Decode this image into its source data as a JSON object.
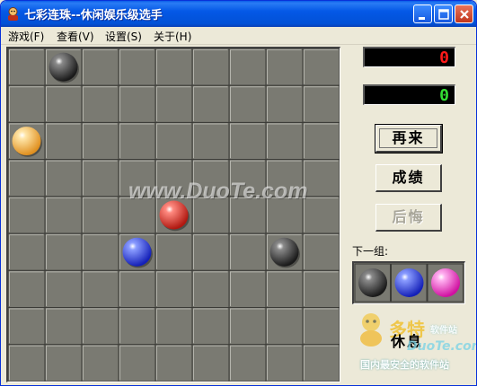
{
  "window": {
    "title": "七彩连珠--休闲娱乐级选手"
  },
  "menu": {
    "items": [
      "游戏(F)",
      "查看(V)",
      "设置(S)",
      "关于(H)"
    ]
  },
  "scores": {
    "current": "0",
    "current_color": "#ff1a1a",
    "best": "0",
    "best_color": "#33dd33"
  },
  "buttons": {
    "restart": "再来",
    "scores": "成绩",
    "undo": "后悔"
  },
  "next_group": {
    "label": "下一组:",
    "balls": [
      "black",
      "blue",
      "magenta"
    ]
  },
  "pause_label": "休息",
  "board": {
    "columns": 9,
    "rows": 9,
    "balls": [
      {
        "col": 1,
        "row": 0,
        "color": "black"
      },
      {
        "col": 0,
        "row": 2,
        "color": "orange"
      },
      {
        "col": 4,
        "row": 4,
        "color": "red"
      },
      {
        "col": 3,
        "row": 5,
        "color": "blue"
      },
      {
        "col": 7,
        "row": 5,
        "color": "black"
      }
    ]
  },
  "palette": {
    "black": [
      "#8a8a8a",
      "#1a1a1a"
    ],
    "orange": [
      "#ffe6a8",
      "#e09020"
    ],
    "red": [
      "#ff8a80",
      "#b01810"
    ],
    "blue": [
      "#8a9cff",
      "#1420b8"
    ],
    "magenta": [
      "#ffb0f0",
      "#d010a0"
    ]
  },
  "watermarks": {
    "center": "www.DuoTe.com",
    "logo_text": "多特",
    "site_text": "软件站",
    "url": "DuoTe.com",
    "slogan": "国内最安全的软件站"
  }
}
